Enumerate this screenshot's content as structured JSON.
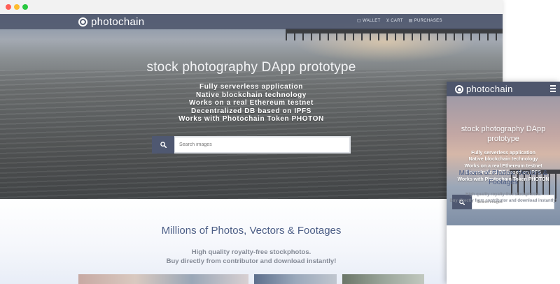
{
  "brand": {
    "name": "photochain"
  },
  "nav": {
    "wallet": "WALLET",
    "cart": "CART",
    "purchases": "PURCHASES"
  },
  "hero": {
    "title": "stock photography DApp prototype",
    "features": [
      "Fully serverless application",
      "Native blockchain technology",
      "Works on a real Ethereum testnet",
      "Decentralized DB based on IPFS",
      "Works with Photochain Token PHOTON"
    ]
  },
  "search": {
    "placeholder": "Search images"
  },
  "section": {
    "title": "Millions of Photos, Vectors & Footages",
    "subtitle_line1": "High quality royalty-free stockphotos.",
    "subtitle_line2": "Buy directly from contributor and download instantly!"
  },
  "icons": {
    "search": "search-icon",
    "wallet": "wallet-icon",
    "cart": "cart-icon",
    "purchases": "purchases-icon",
    "menu": "hamburger-icon"
  },
  "colors": {
    "navbar": "#4e566c",
    "search_button": "#4f5871",
    "heading": "#4c5e86",
    "subtext": "#848a96"
  }
}
